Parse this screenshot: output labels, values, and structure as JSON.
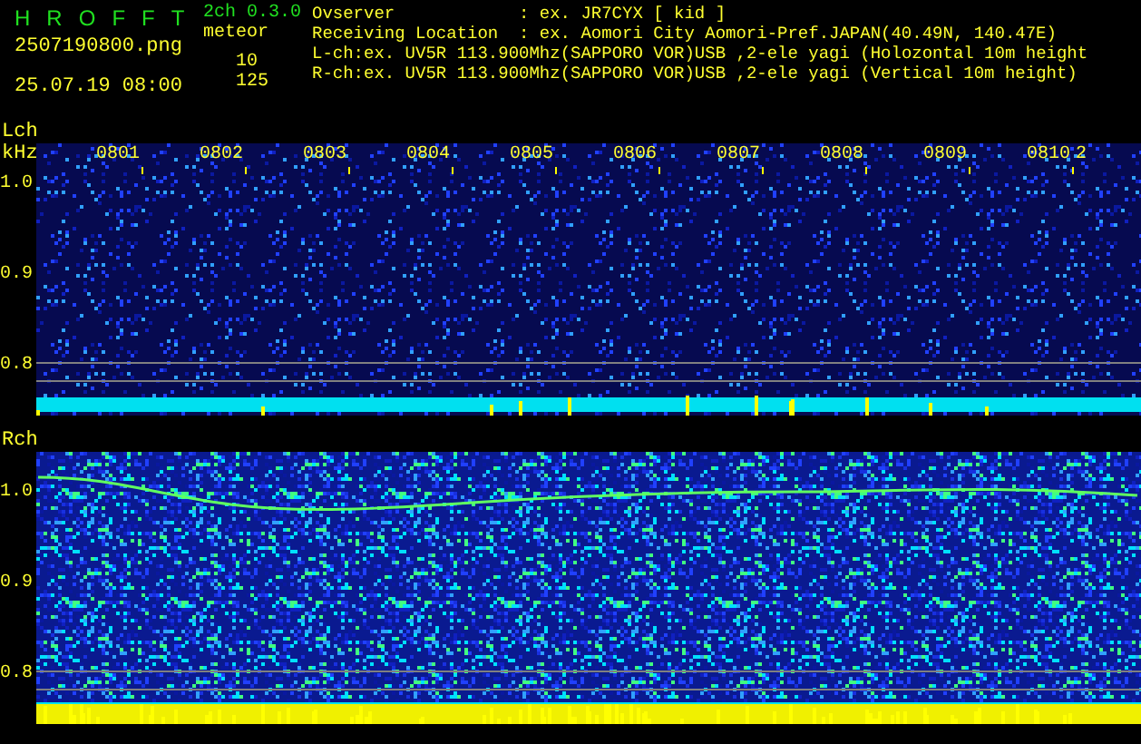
{
  "header": {
    "title_letters": [
      "H",
      "R",
      "O",
      "F",
      "F",
      "T"
    ],
    "version": "2ch 0.3.0",
    "filename": "2507190800.png",
    "datetime": "25.07.19 08:00",
    "counter_label": "meteor",
    "counts": [
      "10",
      "125"
    ]
  },
  "info": [
    {
      "kind": "field",
      "label": "Ovserver",
      "value": ": ex. JR7CYX [ kid ]"
    },
    {
      "kind": "field",
      "label": "Receiving Location",
      "value": ": ex. Aomori City Aomori-Pref.JAPAN(40.49N, 140.47E)"
    },
    {
      "kind": "line",
      "text": "L-ch:ex. UV5R 113.900Mhz(SAPPORO VOR)USB ,2-ele yagi (Holozontal 10m height"
    },
    {
      "kind": "line",
      "text": "R-ch:ex. UV5R 113.900Mhz(SAPPORO VOR)USB ,2-ele yagi (Vertical 10m height)"
    }
  ],
  "time_labels": [
    "0801",
    "0802",
    "0803",
    "0804",
    "0805",
    "0806",
    "0807",
    "0808",
    "0809",
    "0810",
    "2"
  ],
  "panels": [
    {
      "label": "Lch",
      "unit": "kHz",
      "ticks": [
        "1.0",
        "0.9",
        "0.8"
      ]
    },
    {
      "label": "Rch",
      "ticks": [
        "1.0",
        "0.9",
        "0.8"
      ]
    }
  ]
}
